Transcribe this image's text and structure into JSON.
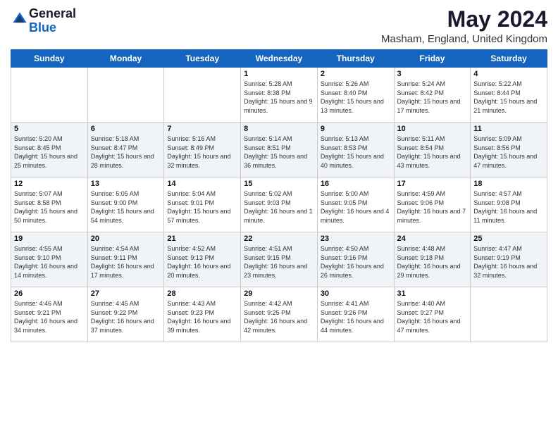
{
  "header": {
    "logo_general": "General",
    "logo_blue": "Blue",
    "month_year": "May 2024",
    "location": "Masham, England, United Kingdom"
  },
  "days_of_week": [
    "Sunday",
    "Monday",
    "Tuesday",
    "Wednesday",
    "Thursday",
    "Friday",
    "Saturday"
  ],
  "weeks": [
    [
      {
        "num": "",
        "sunrise": "",
        "sunset": "",
        "daylight": ""
      },
      {
        "num": "",
        "sunrise": "",
        "sunset": "",
        "daylight": ""
      },
      {
        "num": "",
        "sunrise": "",
        "sunset": "",
        "daylight": ""
      },
      {
        "num": "1",
        "sunrise": "5:28 AM",
        "sunset": "8:38 PM",
        "daylight": "15 hours and 9 minutes."
      },
      {
        "num": "2",
        "sunrise": "5:26 AM",
        "sunset": "8:40 PM",
        "daylight": "15 hours and 13 minutes."
      },
      {
        "num": "3",
        "sunrise": "5:24 AM",
        "sunset": "8:42 PM",
        "daylight": "15 hours and 17 minutes."
      },
      {
        "num": "4",
        "sunrise": "5:22 AM",
        "sunset": "8:44 PM",
        "daylight": "15 hours and 21 minutes."
      }
    ],
    [
      {
        "num": "5",
        "sunrise": "5:20 AM",
        "sunset": "8:45 PM",
        "daylight": "15 hours and 25 minutes."
      },
      {
        "num": "6",
        "sunrise": "5:18 AM",
        "sunset": "8:47 PM",
        "daylight": "15 hours and 28 minutes."
      },
      {
        "num": "7",
        "sunrise": "5:16 AM",
        "sunset": "8:49 PM",
        "daylight": "15 hours and 32 minutes."
      },
      {
        "num": "8",
        "sunrise": "5:14 AM",
        "sunset": "8:51 PM",
        "daylight": "15 hours and 36 minutes."
      },
      {
        "num": "9",
        "sunrise": "5:13 AM",
        "sunset": "8:53 PM",
        "daylight": "15 hours and 40 minutes."
      },
      {
        "num": "10",
        "sunrise": "5:11 AM",
        "sunset": "8:54 PM",
        "daylight": "15 hours and 43 minutes."
      },
      {
        "num": "11",
        "sunrise": "5:09 AM",
        "sunset": "8:56 PM",
        "daylight": "15 hours and 47 minutes."
      }
    ],
    [
      {
        "num": "12",
        "sunrise": "5:07 AM",
        "sunset": "8:58 PM",
        "daylight": "15 hours and 50 minutes."
      },
      {
        "num": "13",
        "sunrise": "5:05 AM",
        "sunset": "9:00 PM",
        "daylight": "15 hours and 54 minutes."
      },
      {
        "num": "14",
        "sunrise": "5:04 AM",
        "sunset": "9:01 PM",
        "daylight": "15 hours and 57 minutes."
      },
      {
        "num": "15",
        "sunrise": "5:02 AM",
        "sunset": "9:03 PM",
        "daylight": "16 hours and 1 minute."
      },
      {
        "num": "16",
        "sunrise": "5:00 AM",
        "sunset": "9:05 PM",
        "daylight": "16 hours and 4 minutes."
      },
      {
        "num": "17",
        "sunrise": "4:59 AM",
        "sunset": "9:06 PM",
        "daylight": "16 hours and 7 minutes."
      },
      {
        "num": "18",
        "sunrise": "4:57 AM",
        "sunset": "9:08 PM",
        "daylight": "16 hours and 11 minutes."
      }
    ],
    [
      {
        "num": "19",
        "sunrise": "4:55 AM",
        "sunset": "9:10 PM",
        "daylight": "16 hours and 14 minutes."
      },
      {
        "num": "20",
        "sunrise": "4:54 AM",
        "sunset": "9:11 PM",
        "daylight": "16 hours and 17 minutes."
      },
      {
        "num": "21",
        "sunrise": "4:52 AM",
        "sunset": "9:13 PM",
        "daylight": "16 hours and 20 minutes."
      },
      {
        "num": "22",
        "sunrise": "4:51 AM",
        "sunset": "9:15 PM",
        "daylight": "16 hours and 23 minutes."
      },
      {
        "num": "23",
        "sunrise": "4:50 AM",
        "sunset": "9:16 PM",
        "daylight": "16 hours and 26 minutes."
      },
      {
        "num": "24",
        "sunrise": "4:48 AM",
        "sunset": "9:18 PM",
        "daylight": "16 hours and 29 minutes."
      },
      {
        "num": "25",
        "sunrise": "4:47 AM",
        "sunset": "9:19 PM",
        "daylight": "16 hours and 32 minutes."
      }
    ],
    [
      {
        "num": "26",
        "sunrise": "4:46 AM",
        "sunset": "9:21 PM",
        "daylight": "16 hours and 34 minutes."
      },
      {
        "num": "27",
        "sunrise": "4:45 AM",
        "sunset": "9:22 PM",
        "daylight": "16 hours and 37 minutes."
      },
      {
        "num": "28",
        "sunrise": "4:43 AM",
        "sunset": "9:23 PM",
        "daylight": "16 hours and 39 minutes."
      },
      {
        "num": "29",
        "sunrise": "4:42 AM",
        "sunset": "9:25 PM",
        "daylight": "16 hours and 42 minutes."
      },
      {
        "num": "30",
        "sunrise": "4:41 AM",
        "sunset": "9:26 PM",
        "daylight": "16 hours and 44 minutes."
      },
      {
        "num": "31",
        "sunrise": "4:40 AM",
        "sunset": "9:27 PM",
        "daylight": "16 hours and 47 minutes."
      },
      {
        "num": "",
        "sunrise": "",
        "sunset": "",
        "daylight": ""
      }
    ]
  ]
}
